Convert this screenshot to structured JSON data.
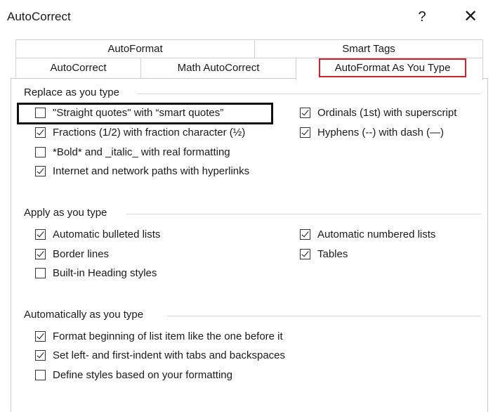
{
  "window": {
    "title": "AutoCorrect",
    "help_label": "?",
    "close_label": "✕"
  },
  "tabs": {
    "row1": [
      {
        "label": "AutoFormat"
      },
      {
        "label": "Smart Tags"
      }
    ],
    "row2": [
      {
        "label": "AutoCorrect"
      },
      {
        "label": "Math AutoCorrect"
      },
      {
        "label": "AutoFormat As You Type",
        "active": true
      }
    ]
  },
  "groups": {
    "replace": {
      "label": "Replace as you type",
      "items": [
        {
          "label": "\"Straight quotes\" with “smart quotes”",
          "checked": false
        },
        {
          "label": "Ordinals (1st) with superscript",
          "checked": true
        },
        {
          "label": "Fractions (1/2) with fraction character (½)",
          "checked": true
        },
        {
          "label": "Hyphens (--) with dash (—)",
          "checked": true
        },
        {
          "label": "*Bold* and _italic_ with real formatting",
          "checked": false
        },
        {
          "label": "Internet and network paths with hyperlinks",
          "checked": true
        }
      ]
    },
    "apply": {
      "label": "Apply as you type",
      "items": [
        {
          "label": "Automatic bulleted lists",
          "checked": true
        },
        {
          "label": "Automatic numbered lists",
          "checked": true
        },
        {
          "label": "Border lines",
          "checked": true
        },
        {
          "label": "Tables",
          "checked": true
        },
        {
          "label": "Built-in Heading styles",
          "checked": false
        }
      ]
    },
    "auto": {
      "label": "Automatically as you type",
      "items": [
        {
          "label": "Format beginning of list item like the one before it",
          "checked": true
        },
        {
          "label": "Set left- and first-indent with tabs and backspaces",
          "checked": true
        },
        {
          "label": "Define styles based on your formatting",
          "checked": false
        }
      ]
    }
  },
  "colors": {
    "active_tab_outline": "#d0202a",
    "highlight_box": "#111111"
  }
}
